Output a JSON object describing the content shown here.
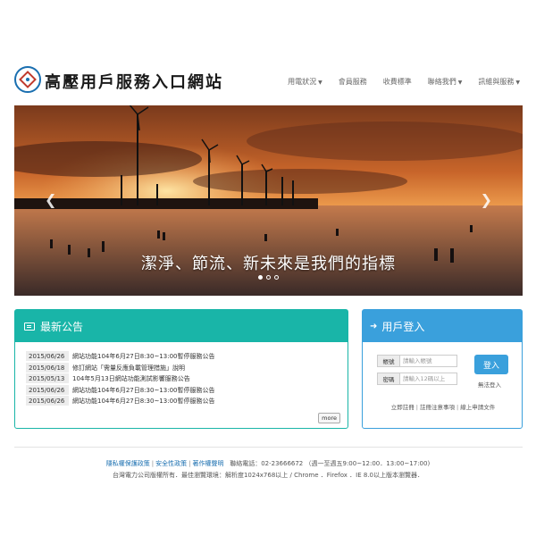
{
  "header": {
    "site_title": "高壓用戶服務入口網站",
    "logo_icon": "taipower-logo-icon"
  },
  "nav": {
    "items": [
      {
        "label": "用電狀況",
        "dropdown": true
      },
      {
        "label": "會員服務",
        "dropdown": false
      },
      {
        "label": "收費標準",
        "dropdown": false
      },
      {
        "label": "聯絡我們",
        "dropdown": true
      },
      {
        "label": "訊維與服務",
        "dropdown": true
      }
    ]
  },
  "banner": {
    "slogan": "潔淨、節流、新未來是我們的指標",
    "prev_icon": "chevron-left-icon",
    "next_icon": "chevron-right-icon",
    "slide_count": 3,
    "active_slide": 1
  },
  "announcements": {
    "title": "最新公告",
    "icon": "newspaper-icon",
    "items": [
      {
        "date": "2015/06/26",
        "text": "網站功能104年6月27日8:30~13:00暫停服務公告"
      },
      {
        "date": "2015/06/18",
        "text": "修訂網站「需量反應負載管理措施」說明"
      },
      {
        "date": "2015/05/13",
        "text": "104年5月13日網站功能測試影響服務公告"
      },
      {
        "date": "2015/06/26",
        "text": "網站功能104年6月27日8:30~13:00暫停服務公告"
      },
      {
        "date": "2015/06/26",
        "text": "網站功能104年6月27日8:30~13:00暫停服務公告"
      }
    ],
    "more_label": "more"
  },
  "login": {
    "title": "用戶登入",
    "icon": "sign-in-icon",
    "account_label": "帳號",
    "account_placeholder": "請輸入帳號",
    "password_label": "密碼",
    "password_placeholder": "請輸入12碼以上",
    "login_button": "登入",
    "guest_link": "無法登入",
    "links": [
      "立即註冊",
      "註冊注意事項",
      "線上申請文件"
    ]
  },
  "footer": {
    "links": [
      "隱私權保護政策",
      "安全性政策",
      "著作權聲明"
    ],
    "phone": "聯絡電話：02-23666672 （週一至週五9:00~12:00．13:00~17:00)",
    "notice": "台灣電力公司版權所有．最佳瀏覽環境：解析度1024x768以上 / Chrome ．Firefox ．IE 8.0以上版本瀏覽器．"
  },
  "colors": {
    "announce_accent": "#19b5a8",
    "login_accent": "#3aa0dc",
    "link_blue": "#1a6fb0"
  }
}
